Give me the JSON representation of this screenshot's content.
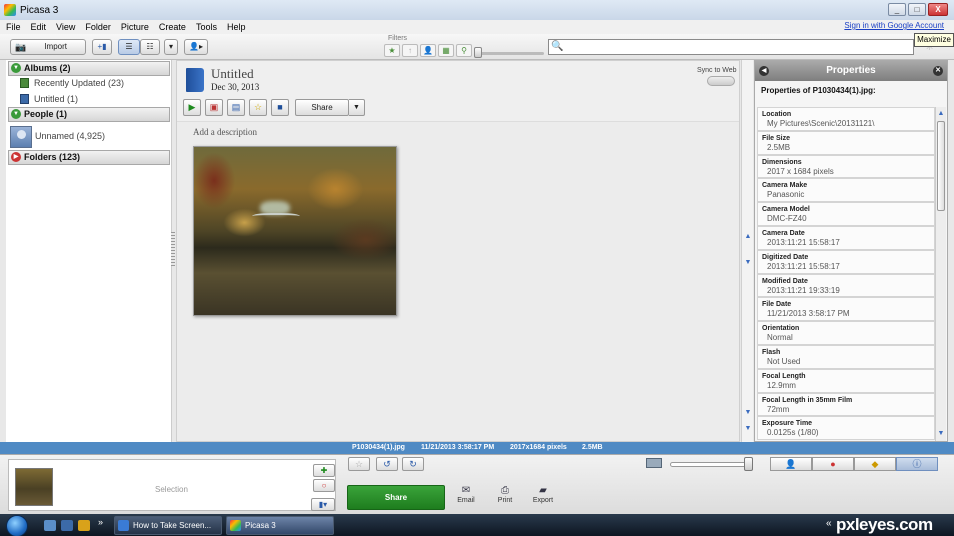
{
  "window": {
    "title": "Picasa 3",
    "buttons": {
      "minimize": "_",
      "maximize": "□",
      "close": "X"
    },
    "tooltip": "Maximize"
  },
  "menu": {
    "items": [
      "File",
      "Edit",
      "View",
      "Folder",
      "Picture",
      "Create",
      "Tools",
      "Help"
    ],
    "signin": "Sign in with Google Account"
  },
  "toolbar": {
    "import_label": "Import",
    "filters_label": "Filters",
    "filter_icons": [
      "★",
      "↑",
      "👤",
      "▦",
      "⚲"
    ],
    "search_placeholder": ""
  },
  "left_panel": {
    "albums_header": "Albums (2)",
    "albums": [
      {
        "label": "Recently Updated (23)"
      },
      {
        "label": "Untitled (1)"
      }
    ],
    "people_header": "People (1)",
    "people": [
      {
        "label": "Unnamed (4,925)"
      }
    ],
    "folders_header": "Folders (123)"
  },
  "album": {
    "title": "Untitled",
    "date": "Dec 30, 2013",
    "sync_label": "Sync to Web",
    "share_label": "Share",
    "description_placeholder": "Add a description"
  },
  "properties": {
    "header": "Properties",
    "subtitle": "Properties of P1030434(1).jpg:",
    "items": [
      {
        "name": "Location",
        "value": "My Pictures\\Scenic\\20131121\\"
      },
      {
        "name": "File Size",
        "value": "2.5MB"
      },
      {
        "name": "Dimensions",
        "value": "2017 x 1684 pixels"
      },
      {
        "name": "Camera Make",
        "value": "Panasonic"
      },
      {
        "name": "Camera Model",
        "value": "DMC-FZ40"
      },
      {
        "name": "Camera Date",
        "value": "2013:11:21 15:58:17"
      },
      {
        "name": "Digitized Date",
        "value": "2013:11:21 15:58:17"
      },
      {
        "name": "Modified Date",
        "value": "2013:11:21 19:33:19"
      },
      {
        "name": "File Date",
        "value": "11/21/2013 3:58:17 PM"
      },
      {
        "name": "Orientation",
        "value": "Normal"
      },
      {
        "name": "Flash",
        "value": "Not Used"
      },
      {
        "name": "Focal Length",
        "value": "12.9mm"
      },
      {
        "name": "Focal Length in 35mm Film",
        "value": "72mm"
      },
      {
        "name": "Exposure Time",
        "value": "0.0125s (1/80)"
      }
    ]
  },
  "status": {
    "filename": "P1030434(1).jpg",
    "datetime": "11/21/2013 3:58:17 PM",
    "dimensions": "2017x1684 pixels",
    "size": "2.5MB"
  },
  "tray": {
    "selection_label": "Selection",
    "share_label": "Share",
    "actions": [
      {
        "label": "Email"
      },
      {
        "label": "Print"
      },
      {
        "label": "Export"
      }
    ]
  },
  "taskbar": {
    "tasks": [
      {
        "label": "How to Take Screen..."
      },
      {
        "label": "Picasa 3"
      }
    ],
    "watermark": "pxleyes.com",
    "chevron": "«"
  }
}
